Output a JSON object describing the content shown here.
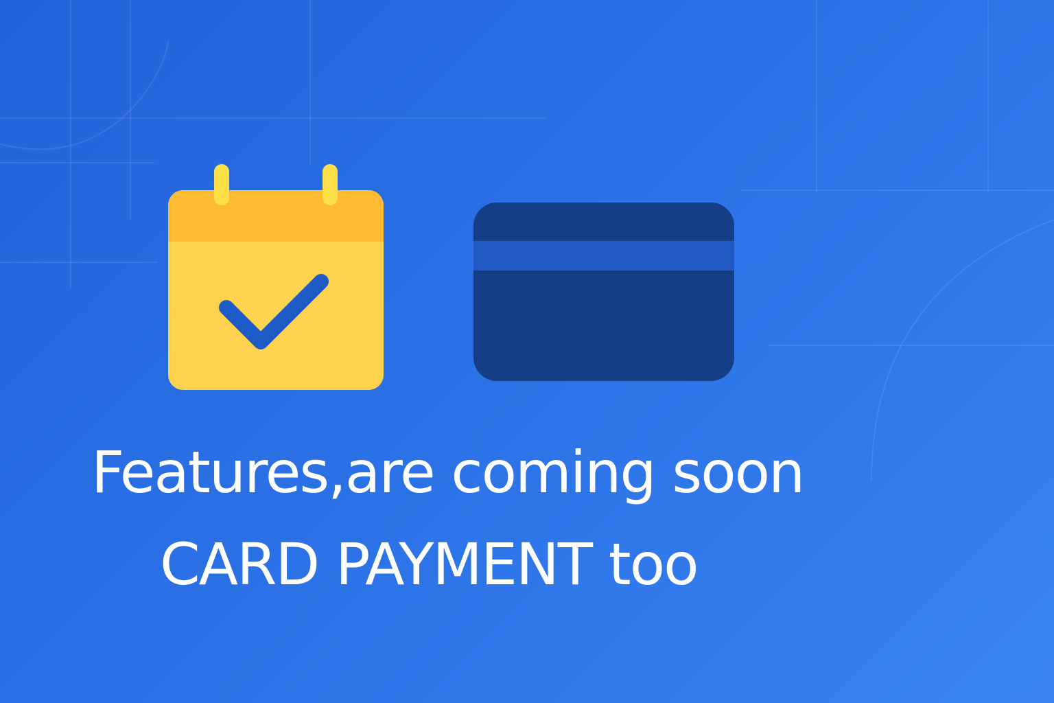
{
  "message": {
    "line1": "Features,are coming soon",
    "line2": "CARD PAYMENT too"
  },
  "icons": {
    "calendar": "calendar-check-icon",
    "card": "credit-card-icon"
  },
  "colors": {
    "background_start": "#2362d9",
    "background_end": "#3a83f2",
    "calendar_body": "#fdd34e",
    "calendar_header": "#fdbc33",
    "calendar_rings": "#fde047",
    "checkmark": "#1e5bc6",
    "card_body": "#143f86",
    "card_stripe": "#1f5bc2",
    "text": "#ffffff"
  }
}
